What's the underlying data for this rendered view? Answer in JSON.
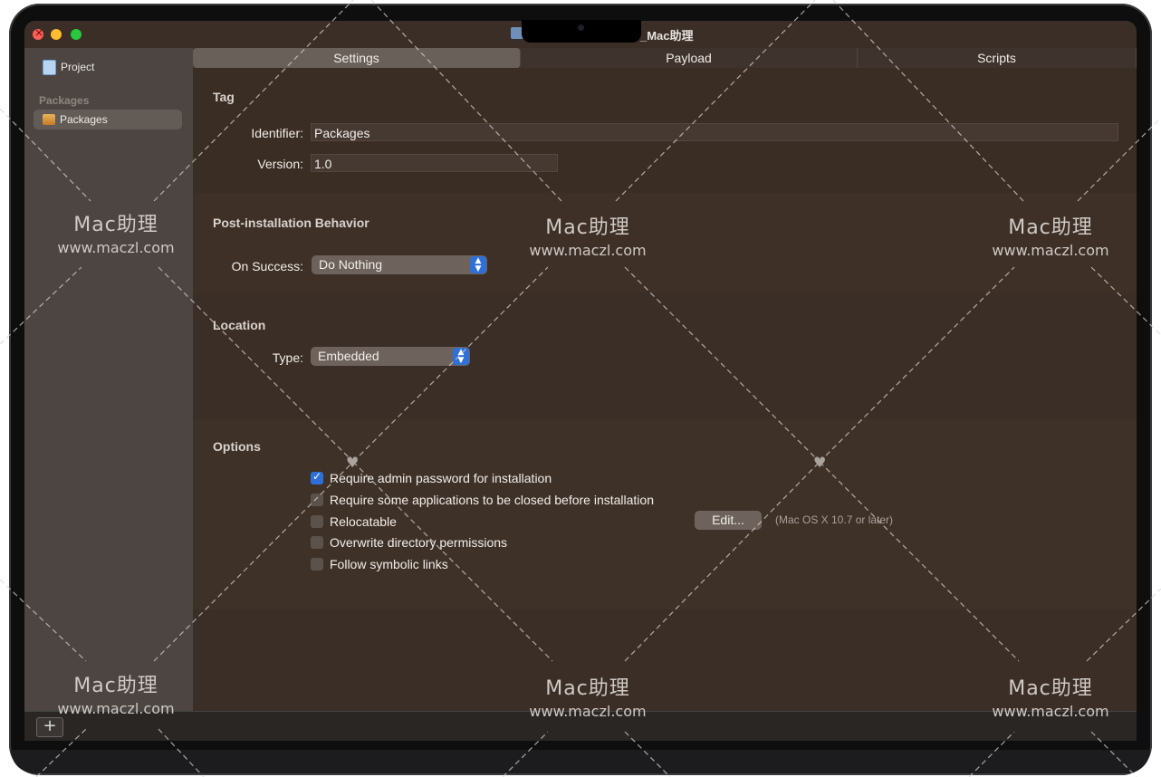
{
  "window": {
    "title": "_Mac助理"
  },
  "sidebar": {
    "project_label": "Project",
    "section_label": "Packages",
    "items": [
      {
        "label": "Packages"
      }
    ],
    "add_label": "+"
  },
  "tabs": [
    {
      "label": "Settings",
      "active": true
    },
    {
      "label": "Payload",
      "active": false
    },
    {
      "label": "Scripts",
      "active": false
    }
  ],
  "tag": {
    "title": "Tag",
    "identifier_label": "Identifier:",
    "identifier_value": "Packages",
    "version_label": "Version:",
    "version_value": "1.0"
  },
  "post_install": {
    "title": "Post-installation Behavior",
    "on_success_label": "On Success:",
    "on_success_value": "Do Nothing"
  },
  "location": {
    "title": "Location",
    "type_label": "Type:",
    "type_value": "Embedded"
  },
  "options": {
    "title": "Options",
    "items": [
      {
        "label": "Require admin password for installation",
        "checked": true
      },
      {
        "label": "Require some applications to be closed before installation",
        "checked": false
      },
      {
        "label": "Relocatable",
        "checked": false
      },
      {
        "label": "Overwrite directory permissions",
        "checked": false
      },
      {
        "label": "Follow symbolic links",
        "checked": false
      }
    ],
    "edit_label": "Edit...",
    "edit_note": "(Mac OS X 10.7 or later)"
  },
  "watermark": {
    "line1": "Mac助理",
    "line2": "www.maczl.com"
  },
  "colors": {
    "accent": "#2e6fd8",
    "background": "#3c2f27",
    "sidebar": "#4c4541"
  }
}
